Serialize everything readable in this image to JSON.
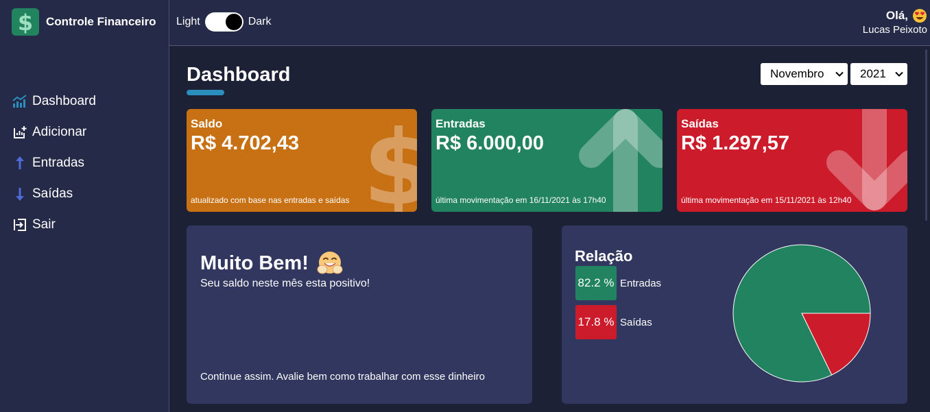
{
  "app": {
    "name": "Controle Financeiro"
  },
  "sidebar": {
    "items": [
      {
        "label": "Dashboard",
        "icon": "chart-icon"
      },
      {
        "label": "Adicionar",
        "icon": "add-chart-icon"
      },
      {
        "label": "Entradas",
        "icon": "arrow-up-icon"
      },
      {
        "label": "Saídas",
        "icon": "arrow-down-icon"
      },
      {
        "label": "Sair",
        "icon": "logout-icon"
      }
    ]
  },
  "header": {
    "theme_light": "Light",
    "theme_dark": "Dark",
    "greeting": "Olá,",
    "user_name": "Lucas Peixoto"
  },
  "page": {
    "title": "Dashboard",
    "month": "Novembro",
    "year": "2021"
  },
  "cards": [
    {
      "label": "Saldo",
      "value": "R$ 4.702,43",
      "footer": "atualizado com base nas entradas e saídas",
      "color": "#c87114",
      "icon": "dollar-icon"
    },
    {
      "label": "Entradas",
      "value": "R$ 6.000,00",
      "footer": "última movimentação em 16/11/2021 às 17h40",
      "color": "#21835f",
      "icon": "arrow-up-icon"
    },
    {
      "label": "Saídas",
      "value": "R$ 1.297,57",
      "footer": "última movimentação em 15/11/2021 às 12h40",
      "color": "#cc1b2a",
      "icon": "arrow-down-icon"
    }
  ],
  "message": {
    "title": "Muito Bem!",
    "description": "Seu saldo neste mês esta positivo!",
    "footer": "Continue assim. Avalie bem como trabalhar com esse dinheiro"
  },
  "relation": {
    "title": "Relação",
    "items": [
      {
        "percent": "82.2 %",
        "label": "Entradas",
        "color": "#21835f"
      },
      {
        "percent": "17.8 %",
        "label": "Saídas",
        "color": "#cc1b2a"
      }
    ]
  },
  "chart_data": {
    "type": "pie",
    "title": "Relação",
    "categories": [
      "Entradas",
      "Saídas"
    ],
    "values": [
      82.2,
      17.8
    ],
    "colors": [
      "#21835f",
      "#cc1b2a"
    ]
  }
}
